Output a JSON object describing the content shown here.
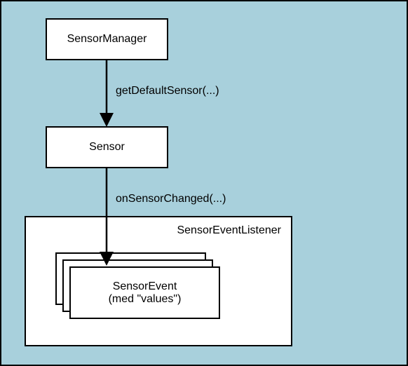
{
  "boxes": {
    "sensorManager": "SensorManager",
    "sensor": "Sensor",
    "sensorEventLine1": "SensorEvent",
    "sensorEventLine2": "(med \"values\")"
  },
  "labels": {
    "getDefaultSensor": "getDefaultSensor(...)",
    "onSensorChanged": "onSensorChanged(...)"
  },
  "listener": {
    "title": "SensorEventListener"
  }
}
